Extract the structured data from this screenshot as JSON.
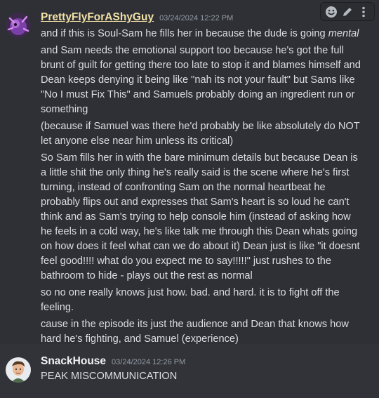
{
  "messages": [
    {
      "author": "PrettyFlyForAShyGuy",
      "timestamp": "03/24/2024 12:22 PM",
      "avatar_icon": "purple-creature-avatar",
      "lines": [
        {
          "pre": "and if this is Soul-Sam he fills her in because the dude is going ",
          "em": "mental"
        },
        "and Sam needs the emotional support too because he's got the full brunt of guilt for getting there too late to stop it and blames himself and Dean keeps denying it being like \"nah its not your fault\" but Sams like \"No I must Fix This\" and Samuels probably doing an ingredient run or something",
        "(because if Samuel was there he'd probably be like absolutely do NOT let anyone else near him unless its critical)",
        "So Sam fills her in with the bare minimum details but because Dean is a little shit the only thing he's really said is the scene where he's first turning, instead of confronting Sam on the normal heartbeat he probably flips out and expresses that Sam's heart is so loud he can't think and as Sam's trying to help console him (instead of asking how he feels in a cold way, he's like talk me through this Dean whats going on how does it feel what can we do about it) Dean just is like \"it doesnt feel good!!!! what do you expect me to say!!!!!\" just rushes to the bathroom to hide - plays out the rest as normal",
        "so no one really knows just how. bad. and hard. it is to fight off the feeling.",
        "cause in the episode its just the audience and Dean that knows how hard he's fighting, and Samuel (experience)"
      ]
    },
    {
      "author": "SnackHouse",
      "timestamp": "03/24/2024 12:26 PM",
      "avatar_icon": "cartoon-man-avatar",
      "lines": [
        "PEAK MISCOMMUNICATION"
      ]
    }
  ],
  "toolbar": {
    "icons": [
      "emoji-icon",
      "edit-icon",
      "more-icon"
    ]
  }
}
